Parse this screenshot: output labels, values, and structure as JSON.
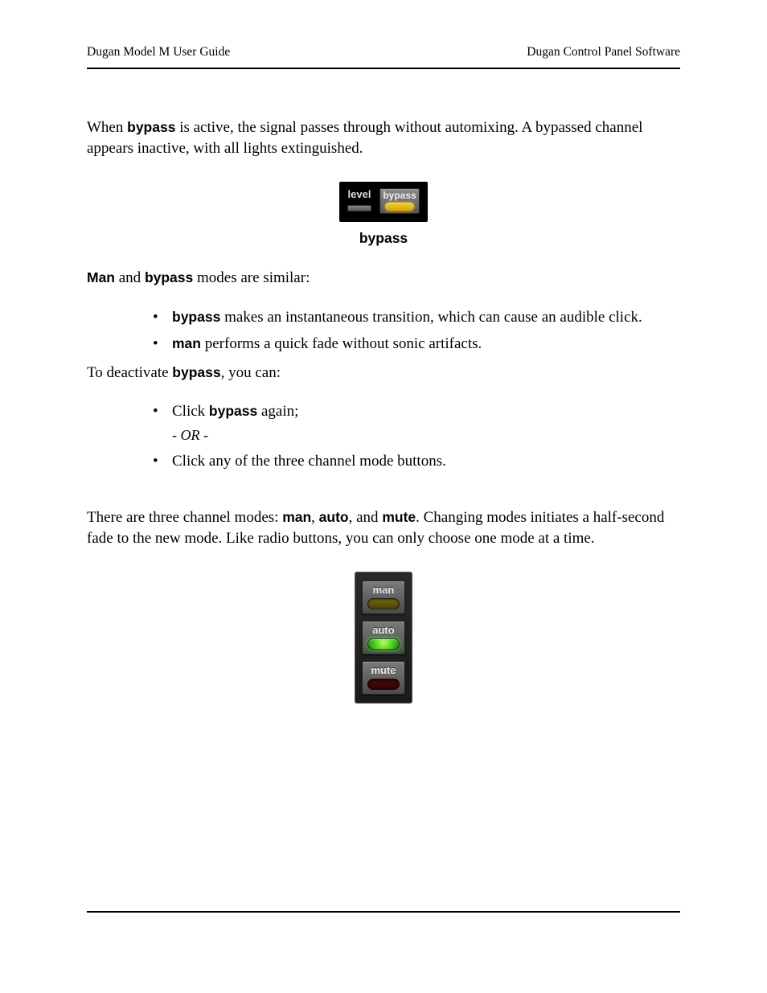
{
  "header": {
    "left": "Dugan Model M User Guide",
    "right": "Dugan Control Panel Software"
  },
  "para1": {
    "pre": "When ",
    "bold": "bypass",
    "post": " is active, the signal passes through without automixing. A bypassed channel appears inactive, with all lights extinguished."
  },
  "fig1": {
    "level_label": "level",
    "bypass_label": "bypass",
    "caption": "bypass"
  },
  "para2": {
    "b1": "Man",
    "mid": " and ",
    "b2": "bypass",
    "post": " modes are similar:"
  },
  "list1": {
    "item1": {
      "bold": "bypass",
      "rest": " makes an instantaneous transition, which can cause an audible click."
    },
    "item2": {
      "bold": "man",
      "rest": " performs a quick fade without sonic artifacts."
    }
  },
  "para3": {
    "pre": "To deactivate ",
    "bold": "bypass",
    "post": ", you can:"
  },
  "list2": {
    "item1": {
      "pre": "Click ",
      "bold": "bypass",
      "post": " again;"
    },
    "or": "- OR -",
    "item2": "Click any of the three channel mode buttons."
  },
  "para4": {
    "pre": "There are three channel modes: ",
    "b1": "man",
    "c1": ", ",
    "b2": "auto",
    "c2": ", and ",
    "b3": "mute",
    "post": ". Changing modes initiates a half-second fade to the new mode. Like radio buttons, you can only choose one mode at a time."
  },
  "fig2": {
    "man": "man",
    "auto": "auto",
    "mute": "mute"
  }
}
